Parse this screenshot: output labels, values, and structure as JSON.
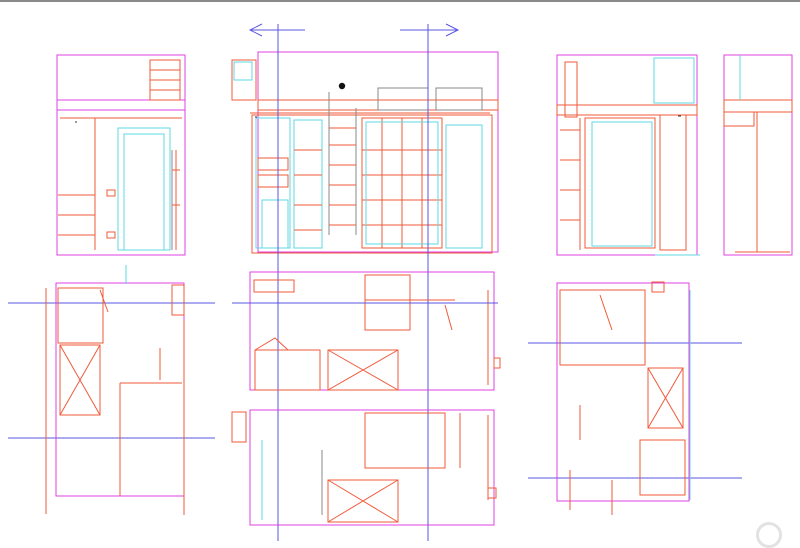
{
  "canvas": {
    "title": "",
    "colors": {
      "magenta": "#e040e0",
      "orange": "#f05a3a",
      "cyan": "#5fd9e6",
      "blue": "#5a55e0",
      "black": "#333333",
      "topbar": "#8a8a8a"
    },
    "views": [
      {
        "name": "elevation-left"
      },
      {
        "name": "elevation-center"
      },
      {
        "name": "elevation-right"
      },
      {
        "name": "elevation-far-right"
      },
      {
        "name": "plan-left"
      },
      {
        "name": "plan-center-upper"
      },
      {
        "name": "plan-center-lower"
      },
      {
        "name": "plan-right"
      }
    ]
  },
  "controls": {
    "zoom_handle_icon": "circle-handle-icon"
  }
}
